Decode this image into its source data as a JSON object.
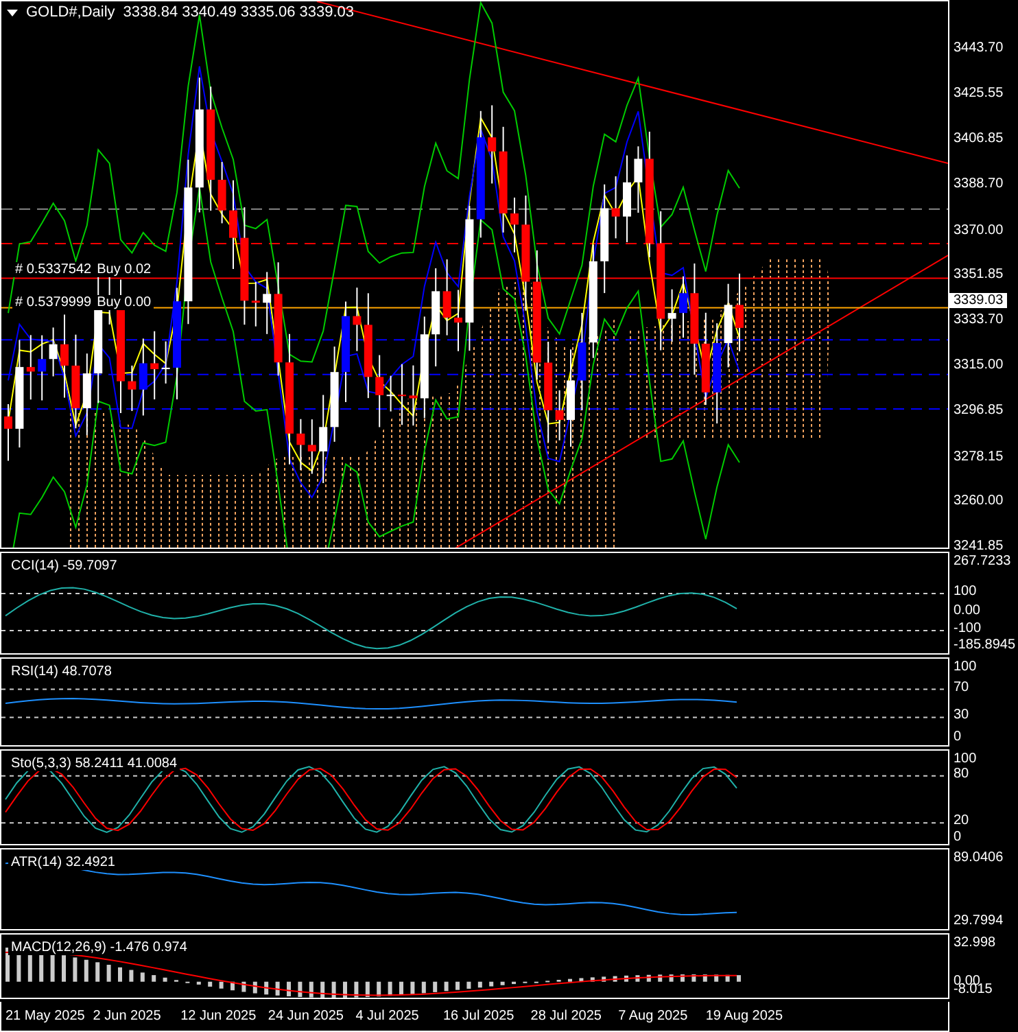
{
  "header": {
    "symbol": "GOLD#,Daily",
    "ohlc": "3338.84 3340.49 3335.06 3339.03"
  },
  "main_panel": {
    "price_labels": [
      "3443.70",
      "3425.55",
      "3406.85",
      "3388.70",
      "3370.00",
      "3351.85",
      "3333.70",
      "3315.00",
      "3296.85",
      "3278.15",
      "3260.00",
      "3241.85"
    ],
    "current_price": "3339.03",
    "order_labels": [
      {
        "ticket": "# 0.5337542",
        "action": "Buy 0.02"
      },
      {
        "ticket": "# 0.5379999",
        "action": "Buy 0.00"
      }
    ]
  },
  "indicators": [
    {
      "kind": "cci",
      "title": "CCI(14) -59.7097",
      "scale": [
        "267.7233",
        "100",
        "0.00",
        "-100",
        "-185.8945"
      ]
    },
    {
      "kind": "rsi",
      "title": "RSI(14) 48.7078",
      "scale": [
        "100",
        "70",
        "30",
        "0"
      ]
    },
    {
      "kind": "stoch",
      "title": "Sto(5,3,3) 58.2411 41.0084",
      "scale": [
        "100",
        "80",
        "20",
        "0"
      ]
    },
    {
      "kind": "atr",
      "title": "ATR(14) 32.4921",
      "scale": [
        "89.0406",
        "29.7994"
      ]
    },
    {
      "kind": "macd",
      "title": "MACD(12,26,9) -1.476 0.974",
      "scale": [
        "32.998",
        "0.00",
        "-8.015"
      ]
    }
  ],
  "dates": [
    "21 May 2025",
    "2 Jun 2025",
    "12 Jun 2025",
    "24 Jun 2025",
    "4 Jul 2025",
    "16 Jul 2025",
    "28 Jul 2025",
    "7 Aug 2025",
    "19 Aug 2025"
  ]
}
